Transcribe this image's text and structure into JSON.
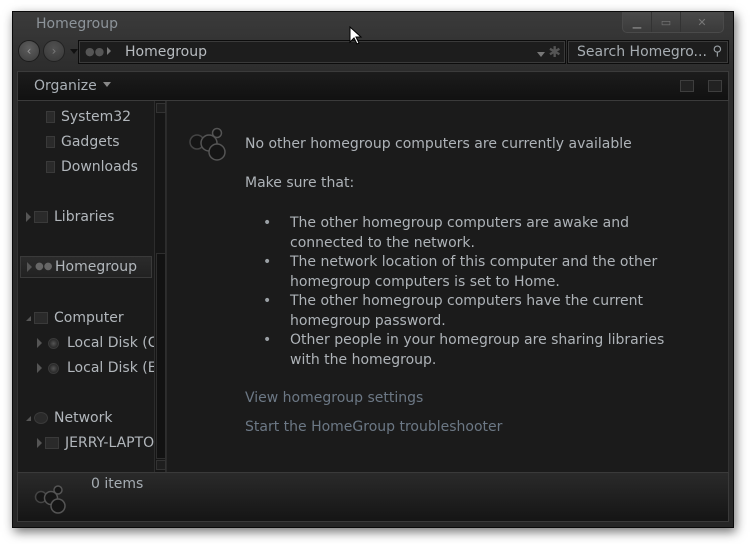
{
  "window": {
    "title": "Homegroup",
    "caption_buttons": [
      {
        "name": "minimize",
        "glyph": "▁"
      },
      {
        "name": "maximize",
        "glyph": "▭"
      },
      {
        "name": "close",
        "glyph": "✕"
      }
    ]
  },
  "navigation": {
    "back_glyph": "‹",
    "forward_glyph": "›",
    "address_icon": "homegroup-icon",
    "address_path": "Homegroup",
    "refresh_glyph": "✱"
  },
  "search": {
    "placeholder": "Search Homegro...",
    "icon_glyph": "⚲"
  },
  "toolbar": {
    "organize_label": "Organize"
  },
  "nav_pane": {
    "items": [
      {
        "label": "System32",
        "icon": "folder-icon",
        "level": 2,
        "expander": "none"
      },
      {
        "label": "Gadgets",
        "icon": "folder-icon",
        "level": 2,
        "expander": "none"
      },
      {
        "label": "Downloads",
        "icon": "folder-icon",
        "level": 2,
        "expander": "none"
      },
      {
        "label": "Libraries",
        "icon": "libraries-icon",
        "level": 0,
        "expander": "collapsed"
      },
      {
        "label": "Homegroup",
        "icon": "homegroup-icon",
        "level": 0,
        "expander": "collapsed",
        "selected": true
      },
      {
        "label": "Computer",
        "icon": "computer-icon",
        "level": 0,
        "expander": "expanded"
      },
      {
        "label": "Local Disk (C:",
        "icon": "disk-icon",
        "level": 1,
        "expander": "collapsed"
      },
      {
        "label": "Local Disk (E:)",
        "icon": "disk-icon",
        "level": 1,
        "expander": "collapsed"
      },
      {
        "label": "Network",
        "icon": "network-icon",
        "level": 0,
        "expander": "expanded"
      },
      {
        "label": "JERRY-LAPTOP",
        "icon": "computer-icon",
        "level": 1,
        "expander": "collapsed"
      }
    ]
  },
  "main": {
    "headline": "No other homegroup computers are currently available",
    "make_sure": "Make sure that:",
    "bullets": [
      "The other homegroup computers are awake and connected to the network.",
      "The network location of this computer and the other homegroup computers is set to Home.",
      "The other homegroup computers have the current homegroup password.",
      "Other people in your homegroup are sharing libraries with the homegroup."
    ],
    "links": {
      "view_settings": "View homegroup settings",
      "troubleshooter": "Start the HomeGroup troubleshooter"
    }
  },
  "status_bar": {
    "items_count": "0 items"
  },
  "colors": {
    "text": "#aeb3b8",
    "link": "#6c7885",
    "background": "#1b1b1b"
  }
}
